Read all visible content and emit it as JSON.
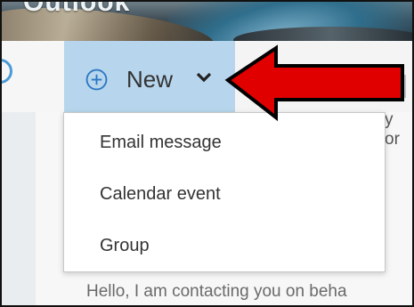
{
  "banner": {
    "brand_text": "Outlook"
  },
  "toolbar": {
    "new_label": "New",
    "icons": {
      "plus": "plus-circle-icon",
      "chevron": "chevron-down-icon",
      "search": "search-icon"
    }
  },
  "menu": {
    "items": [
      {
        "label": "Email message"
      },
      {
        "label": "Calendar event"
      },
      {
        "label": "Group"
      }
    ]
  },
  "content": {
    "preview_tail": "y or",
    "preview_line": "Hello,  I am contacting you on beha"
  },
  "annotation": {
    "arrow_color": "#e00000",
    "arrow_outline": "#000000"
  },
  "colors": {
    "accent": "#4b9bd6",
    "new_button_bg": "#b7d5ec"
  }
}
